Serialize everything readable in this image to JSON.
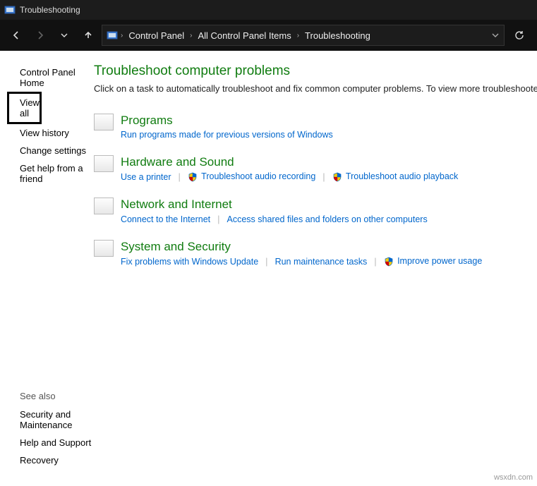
{
  "window": {
    "title": "Troubleshooting"
  },
  "breadcrumb": {
    "items": [
      "Control Panel",
      "All Control Panel Items",
      "Troubleshooting"
    ]
  },
  "sidebar": {
    "items": [
      {
        "label": "Control Panel Home"
      },
      {
        "label": "View all"
      },
      {
        "label": "View history"
      },
      {
        "label": "Change settings"
      },
      {
        "label": "Get help from a friend"
      }
    ]
  },
  "see_also": {
    "header": "See also",
    "items": [
      {
        "label": "Security and Maintenance"
      },
      {
        "label": "Help and Support"
      },
      {
        "label": "Recovery"
      }
    ]
  },
  "main": {
    "heading": "Troubleshoot computer problems",
    "description": "Click on a task to automatically troubleshoot and fix common computer problems. To view more troubleshooters, click on a category or use the Search box.",
    "categories": [
      {
        "title": "Programs",
        "links": [
          {
            "label": "Run programs made for previous versions of Windows",
            "shield": false
          }
        ]
      },
      {
        "title": "Hardware and Sound",
        "links": [
          {
            "label": "Use a printer",
            "shield": false
          },
          {
            "label": "Troubleshoot audio recording",
            "shield": true
          },
          {
            "label": "Troubleshoot audio playback",
            "shield": true
          }
        ]
      },
      {
        "title": "Network and Internet",
        "links": [
          {
            "label": "Connect to the Internet",
            "shield": false
          },
          {
            "label": "Access shared files and folders on other computers",
            "shield": false
          }
        ]
      },
      {
        "title": "System and Security",
        "links": [
          {
            "label": "Fix problems with Windows Update",
            "shield": false
          },
          {
            "label": "Run maintenance tasks",
            "shield": false
          },
          {
            "label": "Improve power usage",
            "shield": true
          }
        ]
      }
    ]
  },
  "watermark": "wsxdn.com"
}
